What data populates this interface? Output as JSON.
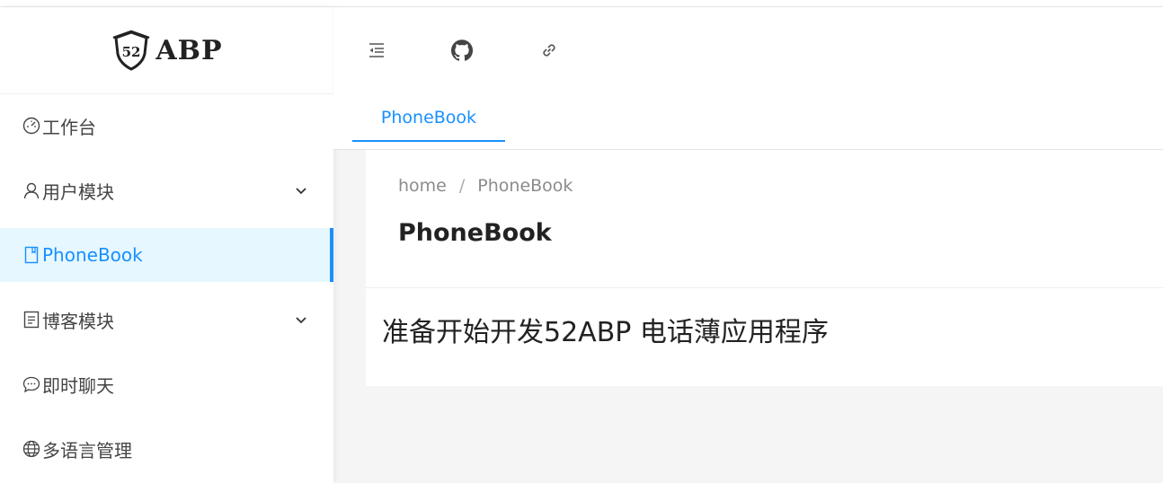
{
  "brand": {
    "logo_text": "ABP",
    "badge_text": "52"
  },
  "sidebar": {
    "items": [
      {
        "label": "工作台",
        "icon": "dashboard-icon",
        "active": false,
        "expandable": false
      },
      {
        "label": "用户模块",
        "icon": "user-icon",
        "active": false,
        "expandable": true
      },
      {
        "label": "PhoneBook",
        "icon": "book-icon",
        "active": true,
        "expandable": false
      },
      {
        "label": "博客模块",
        "icon": "blog-icon",
        "active": false,
        "expandable": true
      },
      {
        "label": "即时聊天",
        "icon": "chat-icon",
        "active": false,
        "expandable": false
      },
      {
        "label": "多语言管理",
        "icon": "globe-icon",
        "active": false,
        "expandable": false
      }
    ]
  },
  "header": {
    "icons": [
      "menu-fold-icon",
      "github-icon",
      "link-icon"
    ]
  },
  "tabs": [
    {
      "label": "PhoneBook",
      "active": true
    }
  ],
  "page": {
    "breadcrumb": [
      "home",
      "PhoneBook"
    ],
    "title": "PhoneBook",
    "content": "准备开始开发52ABP 电话薄应用程序"
  },
  "colors": {
    "accent": "#1890ff",
    "active_bg": "#e6f7ff",
    "page_bg": "#f5f5f5"
  }
}
